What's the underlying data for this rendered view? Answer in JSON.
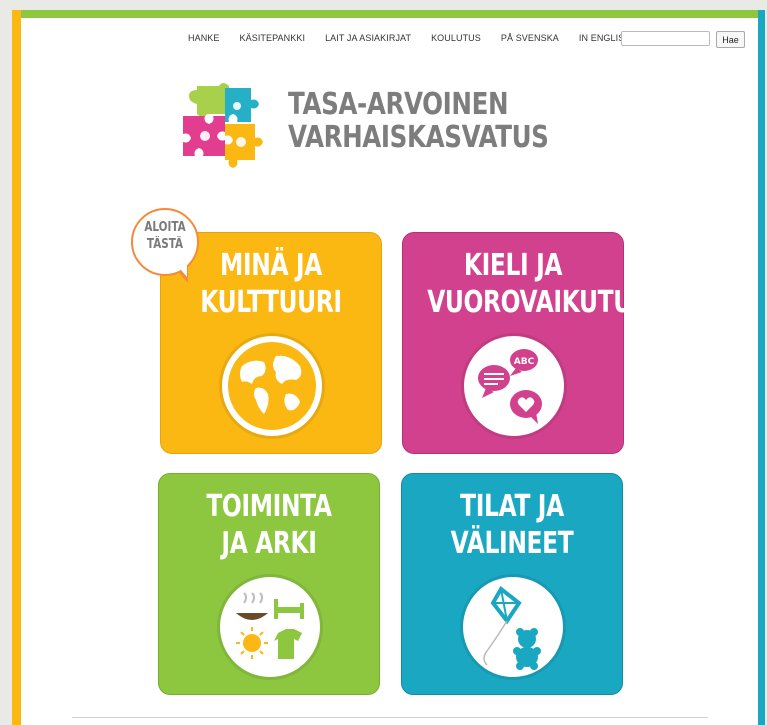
{
  "nav": {
    "items": [
      {
        "label": "HANKE"
      },
      {
        "label": "KÄSITEPANKKI"
      },
      {
        "label": "LAIT JA ASIAKIRJAT"
      },
      {
        "label": "KOULUTUS"
      },
      {
        "label": "PÅ SVENSKA"
      },
      {
        "label": "IN ENGLISH"
      }
    ]
  },
  "search": {
    "placeholder": "",
    "button_label": "Hae"
  },
  "logo": {
    "line1": "TASA-ARVOINEN",
    "line2": "VARHAISKASVATUS"
  },
  "badge": {
    "line1": "ALOITA",
    "line2": "TÄSTÄ"
  },
  "tiles": [
    {
      "line1": "MINÄ JA",
      "line2": "KULTTUURI",
      "icon": "globe-icon",
      "color": "#fbb812"
    },
    {
      "line1": "KIELI JA",
      "line2": "VUOROVAIKUTUS",
      "icon": "speech-bubbles-icon",
      "color": "#d2418d",
      "icon_text": "ABC"
    },
    {
      "line1": "TOIMINTA",
      "line2": "JA ARKI",
      "icon": "daily-life-icon",
      "color": "#8dc63f"
    },
    {
      "line1": "TILAT JA",
      "line2": "VÄLINEET",
      "icon": "kite-teddy-icon",
      "color": "#1aa7c2"
    }
  ],
  "colors": {
    "green": "#8dc63f",
    "yellow": "#fbb812",
    "pink": "#d2418d",
    "teal": "#1aa7c2",
    "orange": "#f58a3a"
  }
}
